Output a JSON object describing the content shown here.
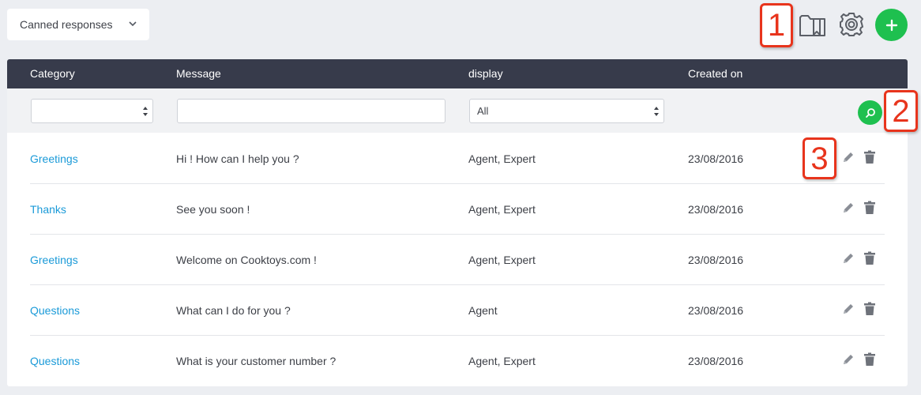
{
  "toolbar": {
    "view_selector_label": "Canned responses",
    "icons": [
      "folder-bookmark-icon",
      "gear-icon",
      "plus-icon"
    ],
    "accent_color": "#1ec04f"
  },
  "annotations": [
    "1",
    "2",
    "3"
  ],
  "table": {
    "headers": {
      "category": "Category",
      "message": "Message",
      "display": "display",
      "created_on": "Created on"
    },
    "filters": {
      "category_value": "",
      "message_value": "",
      "display_value": "All"
    },
    "rows": [
      {
        "category": "Greetings",
        "message": "Hi ! How can I help you ?",
        "display": "Agent, Expert",
        "created_on": "23/08/2016"
      },
      {
        "category": "Thanks",
        "message": "See you soon !",
        "display": "Agent, Expert",
        "created_on": "23/08/2016"
      },
      {
        "category": "Greetings",
        "message": "Welcome on Cooktoys.com !",
        "display": "Agent, Expert",
        "created_on": "23/08/2016"
      },
      {
        "category": "Questions",
        "message": "What can I do for you ?",
        "display": "Agent",
        "created_on": "23/08/2016"
      },
      {
        "category": "Questions",
        "message": "What is your customer number ?",
        "display": "Agent, Expert",
        "created_on": "23/08/2016"
      }
    ]
  }
}
